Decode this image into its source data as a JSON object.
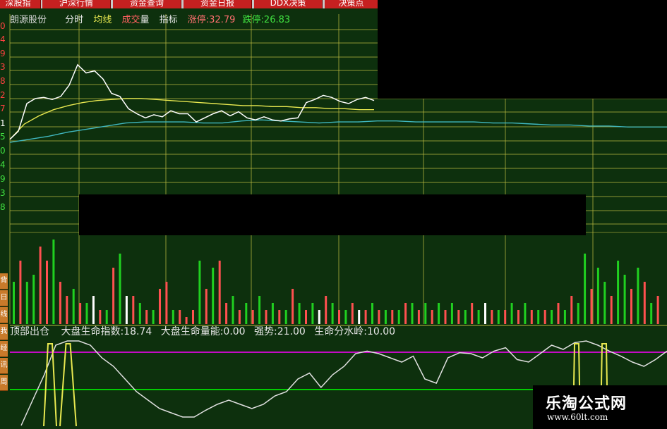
{
  "tabs": [
    "深股指",
    "沪深行情",
    "资金查询",
    "资金日报",
    "DDX决策",
    "决策点"
  ],
  "stock_name": "朗源股份",
  "header_labels": {
    "fenshi": "分时",
    "junxian": "均线",
    "chengjiao_1": "成交",
    "chengjiao_2": "量",
    "zhibiao": "指标",
    "limit_up": "涨停:32.79",
    "limit_down": "跌停:26.83"
  },
  "indicator": {
    "name": "顶部出仓",
    "market_life": "大盘生命指数:18.74",
    "market_energy": "大盘生命量能:0.00",
    "strength": "强势:21.00",
    "watershed": "生命分水岭:10.00"
  },
  "left_axis": {
    "labels": [
      "0",
      "4",
      "9",
      "3",
      "8",
      "2",
      "7",
      "1",
      "5",
      "0",
      "4",
      "9",
      "3",
      "8"
    ],
    "colors": [
      "#ff4040",
      "#ff4040",
      "#ff4040",
      "#ff4040",
      "#ff4040",
      "#ff4040",
      "#ff4040",
      "#ffffff",
      "#40e040",
      "#40e040",
      "#40e040",
      "#40e040",
      "#40e040",
      "#40e040"
    ]
  },
  "side_buttons": [
    "背",
    "日",
    "线",
    "我",
    "经",
    "讯",
    "周"
  ],
  "watermark": {
    "name": "乐淘公式网",
    "url": "www.60lt.com"
  },
  "colors": {
    "background": "#0d300d",
    "grid": "#b8b840",
    "price_line": "#ffffff",
    "avg_line": "#e8e850",
    "cyan_line": "#40b8c0",
    "vol_up": "#ff5050",
    "vol_down": "#20d020",
    "vol_neutral": "#ffffff",
    "magenta_line": "#ff00ff",
    "green_line": "#00ff00",
    "tab_red": "#c62020"
  },
  "chart_data": {
    "type": "line",
    "series": [
      {
        "values": [
          5,
          13,
          40,
          45,
          46,
          44,
          47,
          58,
          78,
          70,
          72,
          64,
          50,
          47,
          35,
          30,
          26,
          29,
          27,
          33,
          30,
          30,
          22,
          26,
          30,
          33,
          28,
          32,
          26,
          24,
          27,
          24,
          23,
          25,
          26,
          41,
          44,
          48,
          46,
          42,
          40,
          44,
          46,
          43
        ]
      },
      {
        "values": [
          5,
          20,
          28,
          34,
          38,
          41,
          43,
          44,
          45,
          45,
          44,
          43,
          42,
          41,
          40,
          39,
          38,
          38,
          37,
          37,
          36,
          36,
          35,
          35,
          34,
          34
        ]
      },
      {
        "values": [
          2,
          5,
          8,
          12,
          15,
          18,
          21,
          22,
          22,
          22,
          21,
          21,
          23,
          24,
          23,
          22,
          21,
          22,
          22,
          23,
          23,
          22,
          22,
          22,
          22,
          21,
          21,
          20,
          19,
          19,
          18,
          18,
          17,
          17,
          17
        ]
      }
    ],
    "volume": {
      "values": [
        6,
        9,
        6,
        7,
        11,
        9,
        12,
        6,
        4,
        5,
        3,
        3,
        4,
        2,
        2,
        8,
        10,
        4,
        4,
        3,
        2,
        2,
        5,
        6,
        2,
        2,
        1,
        2,
        9,
        5,
        8,
        9,
        3,
        4,
        2,
        3,
        2,
        4,
        2,
        3,
        2,
        2,
        5,
        3,
        2,
        3,
        2,
        4,
        3,
        2,
        2,
        3,
        2,
        2,
        3,
        2,
        2,
        2,
        2,
        3,
        3,
        2,
        3,
        2,
        3,
        2,
        3,
        2,
        2,
        3,
        2,
        3,
        2,
        2,
        2,
        3,
        2,
        3,
        2,
        2,
        2,
        2,
        3,
        2,
        4,
        3,
        10,
        5,
        8,
        6,
        4,
        9,
        7,
        5,
        8,
        6,
        3,
        4
      ],
      "dir": [
        "d",
        "u",
        "d",
        "d",
        "u",
        "u",
        "d",
        "u",
        "u",
        "d",
        "u",
        "d",
        "n",
        "u",
        "d",
        "u",
        "d",
        "n",
        "u",
        "d",
        "u",
        "d",
        "u",
        "u",
        "d",
        "u",
        "u",
        "u",
        "d",
        "u",
        "d",
        "u",
        "u",
        "d",
        "u",
        "d",
        "u",
        "d",
        "u",
        "d",
        "u",
        "d",
        "u",
        "d",
        "u",
        "d",
        "n",
        "u",
        "d",
        "u",
        "d",
        "u",
        "n",
        "u",
        "d",
        "u",
        "d",
        "u",
        "d",
        "u",
        "d",
        "u",
        "d",
        "u",
        "d",
        "u",
        "d",
        "u",
        "d",
        "u",
        "d",
        "n",
        "u",
        "d",
        "u",
        "d",
        "u",
        "d",
        "u",
        "d",
        "u",
        "d",
        "u",
        "d",
        "u",
        "d",
        "d",
        "u",
        "d",
        "d",
        "u",
        "d",
        "d",
        "u",
        "d",
        "u",
        "d",
        "u"
      ]
    },
    "indicator_line": {
      "values": [
        0,
        30,
        60,
        95,
        100,
        100,
        95,
        80,
        70,
        55,
        40,
        30,
        20,
        15,
        10,
        10,
        18,
        25,
        30,
        25,
        20,
        25,
        35,
        40,
        55,
        62,
        45,
        60,
        70,
        85,
        88,
        85,
        80,
        75,
        82,
        55,
        50,
        80,
        86,
        85,
        80,
        88,
        92,
        78,
        75,
        85,
        95,
        90,
        98,
        100,
        95,
        88,
        82,
        75,
        70,
        78,
        88
      ]
    },
    "levels": {
      "strength": 21.0,
      "watershed": 10.0
    }
  }
}
